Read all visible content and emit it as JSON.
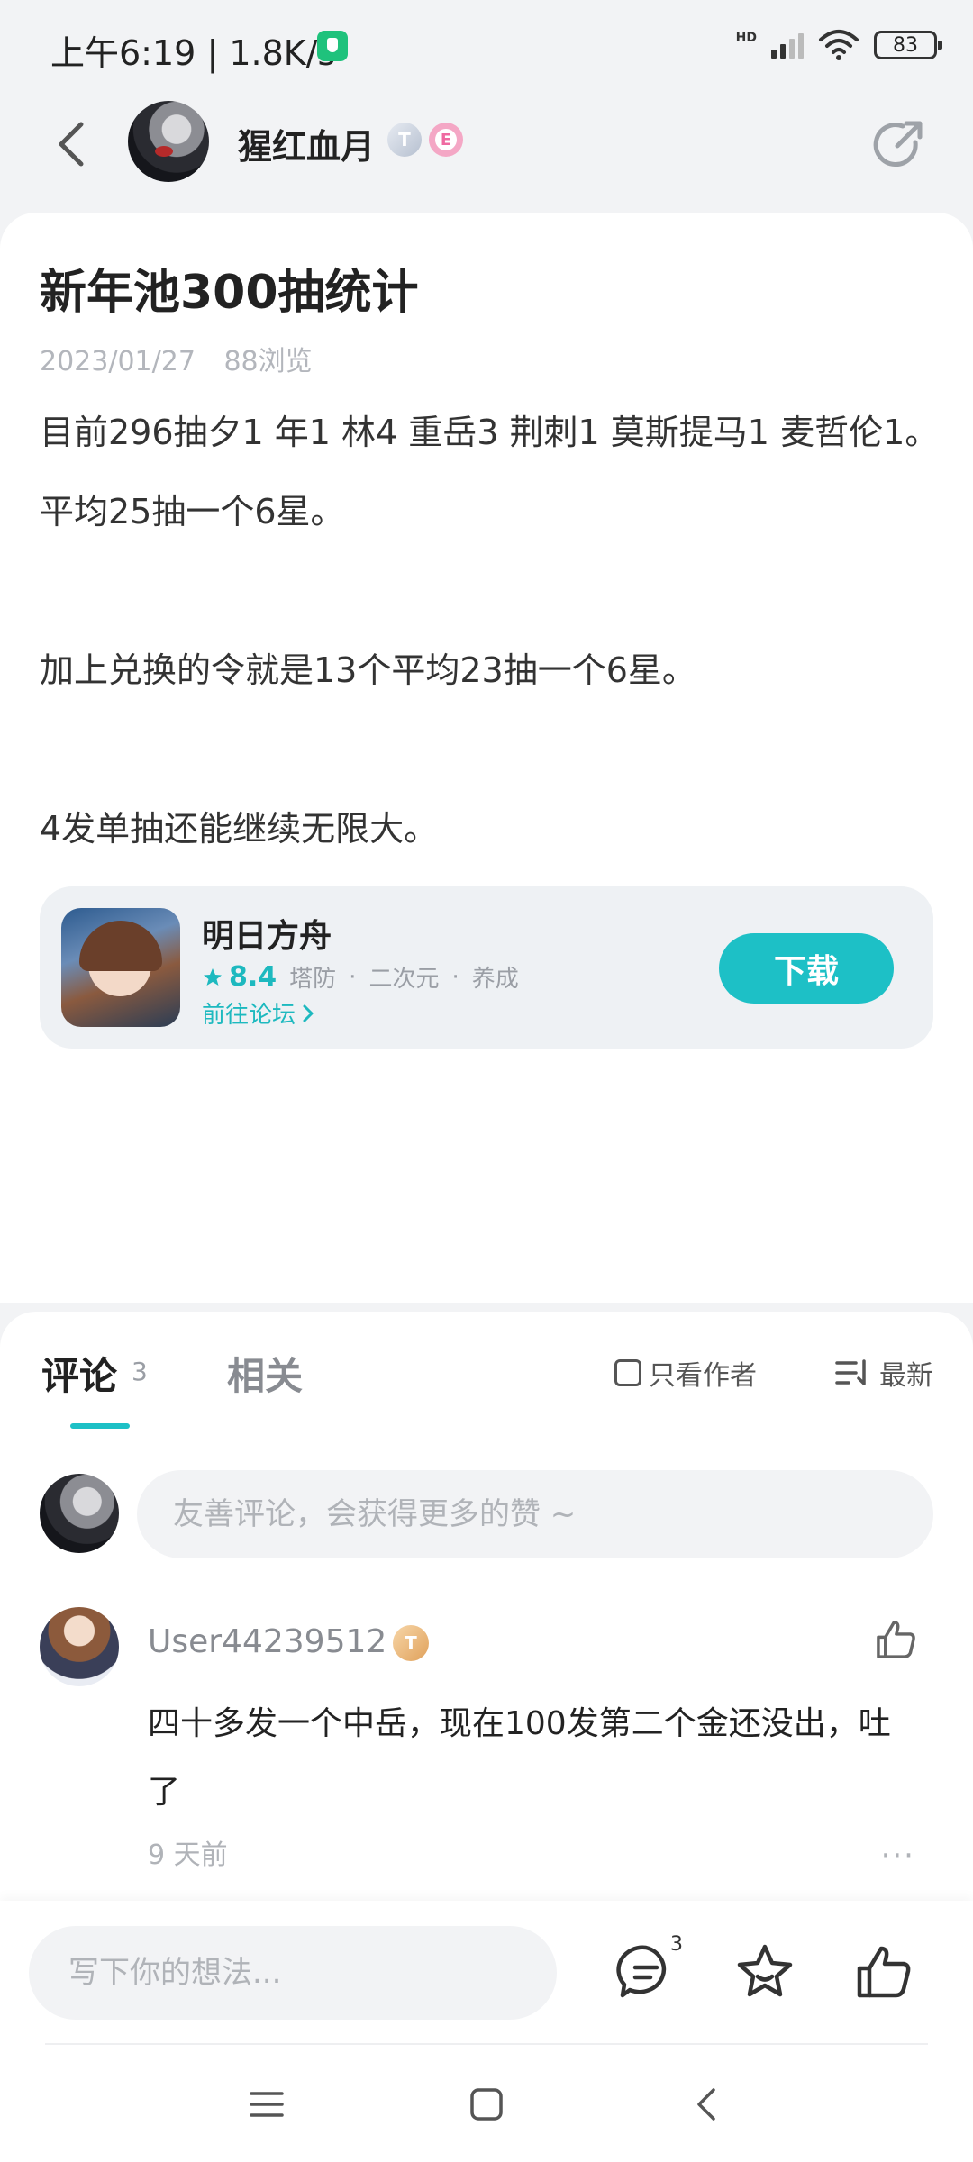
{
  "status": {
    "time": "上午6:19",
    "net_speed": "1.8K/s",
    "network_label": "HD",
    "battery": "83"
  },
  "header": {
    "author": "猩红血月",
    "level_badge": "T",
    "sub_badge": "E"
  },
  "post": {
    "title": "新年池300抽统计",
    "date": "2023/01/27",
    "views": "88浏览",
    "paragraphs": [
      "目前296抽夕1 年1 林4 重岳3 荆刺1 莫斯提马1 麦哲伦1。平均25抽一个6星。",
      "加上兑换的令就是13个平均23抽一个6星。",
      "4发单抽还能继续无限大。"
    ]
  },
  "actions": {
    "like_icon": "thumbs-up-icon",
    "favorite_icon": "star-icon",
    "share_icon": "wechat-icon"
  },
  "game": {
    "name": "明日方舟",
    "rating": "8.4",
    "tags": [
      "塔防",
      "二次元",
      "养成"
    ],
    "forum_link": "前往论坛",
    "download_label": "下载",
    "accent": "#1dc0c6"
  },
  "comments": {
    "tab_comment": "评论",
    "count": "3",
    "tab_related": "相关",
    "author_only": "只看作者",
    "sort": "最新",
    "input_placeholder": "友善评论，会获得更多的赞 ~",
    "items": [
      {
        "user": "User44239512",
        "badge": "T",
        "text": "四十多发一个中岳，现在100发第二个金还没出，吐了",
        "time": "9 天前",
        "more": "···"
      }
    ]
  },
  "bottom_bar": {
    "input_placeholder": "写下你的想法...",
    "comment_count": "3"
  }
}
